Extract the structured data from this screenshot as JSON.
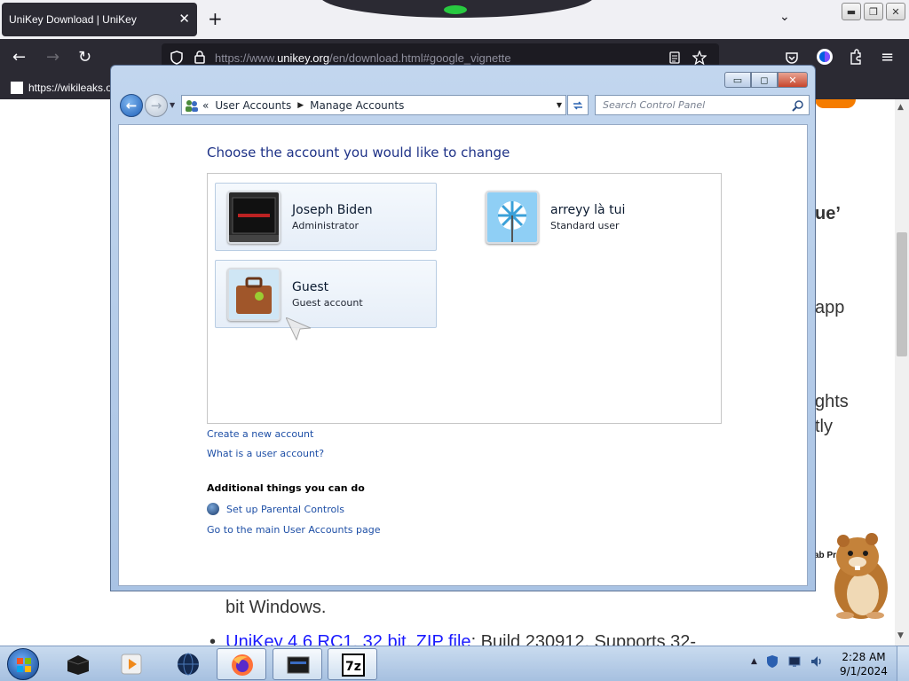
{
  "browser": {
    "tab_title": "UniKey Download | UniKey",
    "tab_close": "✕",
    "new_tab": "+",
    "list_tabs": "⌄",
    "url_prefix": "https://www.",
    "url_domain": "unikey.org",
    "url_suffix": "/en/download.html#google_vignette",
    "bookmark_label": "https://wikileaks.o",
    "back": "←",
    "forward": "→",
    "reload": "↻",
    "menu": "≡"
  },
  "page": {
    "frag_ue": "ue’",
    "frag_app": "app",
    "frag_ghts": "ghts",
    "frag_tly": "tly",
    "frag_ab": "ab Pr",
    "bit_windows": "bit Windows.",
    "bullet_link": "UniKey 4.6 RC1, 32 bit, ZIP file",
    "bullet_rest": ": Build 230912. Supports 32-"
  },
  "cp_window": {
    "min": "▭",
    "max": "◻",
    "close": "✕",
    "breadcrumb_root": "«",
    "breadcrumbs": [
      "User Accounts",
      "Manage Accounts"
    ],
    "search_placeholder": "Search Control Panel",
    "heading": "Choose the account you would like to change",
    "accounts": [
      {
        "name": "Joseph Biden",
        "type": "Administrator"
      },
      {
        "name": "arreyy là tui",
        "type": "Standard user"
      },
      {
        "name": "Guest",
        "type": "Guest account"
      }
    ],
    "links": {
      "create_account": "Create a new account",
      "what_is": "What is a user account?",
      "parental": "Set up Parental Controls",
      "main_page": "Go to the main User Accounts page"
    },
    "additional_heading": "Additional things you can do"
  },
  "taskbar": {
    "clock_time": "2:28 AM",
    "clock_date": "9/1/2024",
    "tray_expand": "▲",
    "task_icons": [
      "box-icon",
      "media-player-icon",
      "globe-icon",
      "firefox-icon",
      "terminal-icon",
      "7zip-icon"
    ]
  },
  "colors": {
    "cp_link": "#1e4fa6",
    "cp_heading": "#1e3287",
    "ff_dark": "#2b2a33",
    "accent_orange": "#f57c00"
  }
}
